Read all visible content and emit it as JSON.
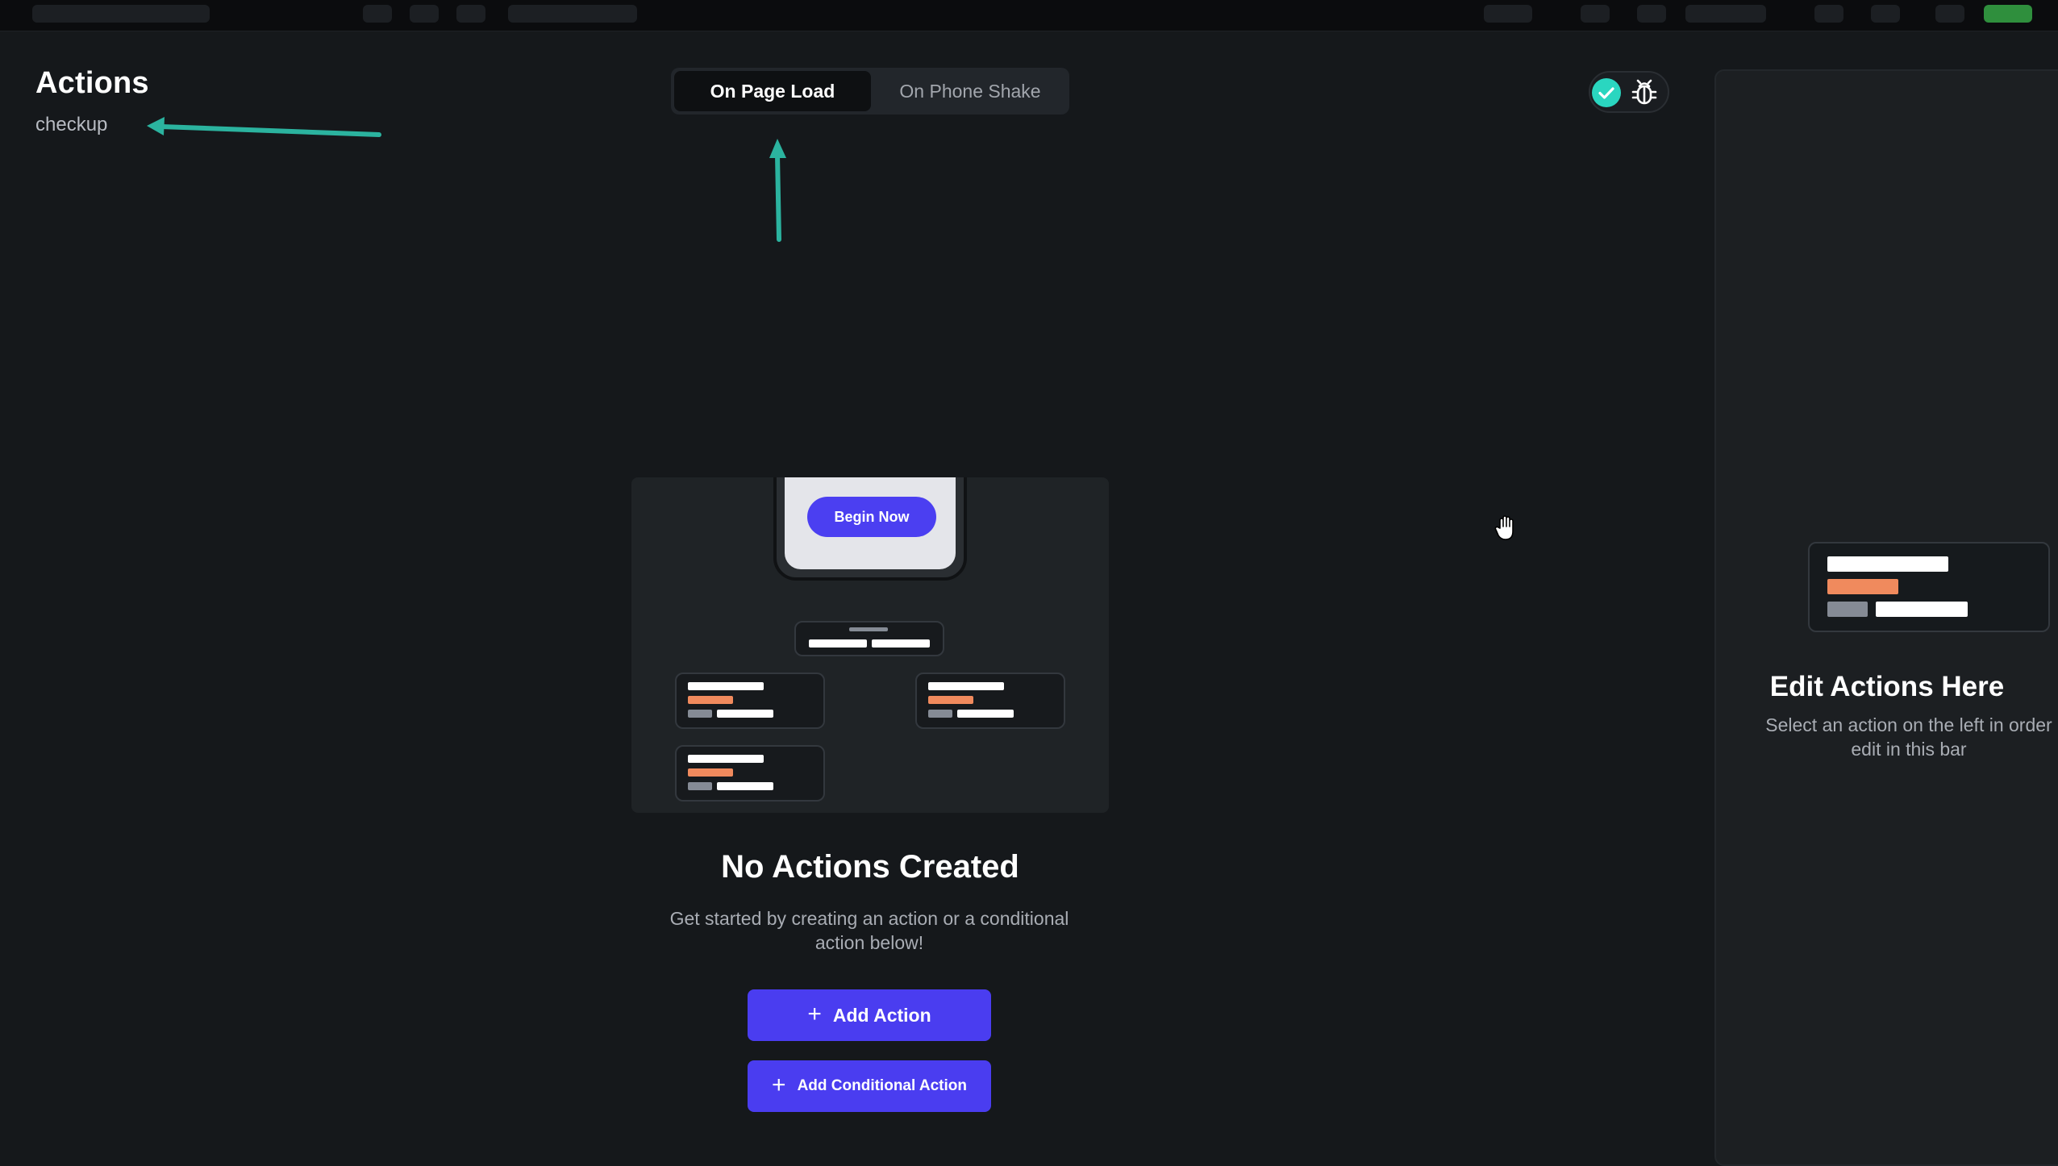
{
  "header": {
    "title": "Actions",
    "subtitle": "checkup"
  },
  "tabs": [
    {
      "label": "On Page Load",
      "active": true
    },
    {
      "label": "On Phone Shake",
      "active": false
    }
  ],
  "toolbar": {
    "status_icon": "check-circle-icon",
    "debug_icon": "bug-icon"
  },
  "illustration": {
    "phone_button_label": "Begin Now"
  },
  "empty_state": {
    "title": "No Actions Created",
    "description": "Get started by creating an action or a conditional action below!"
  },
  "buttons": {
    "add_action": "Add Action",
    "add_conditional_action": "Add Conditional Action"
  },
  "right_panel": {
    "title": "Edit Actions Here",
    "description_line1": "Select an action on the left in order",
    "description_line2": "edit in this bar"
  },
  "colors": {
    "accent": "#4a3df0",
    "annotation_arrow": "#2bb39f",
    "success": "#2ad6c0",
    "orange": "#f08a5d",
    "background": "#15181b"
  }
}
